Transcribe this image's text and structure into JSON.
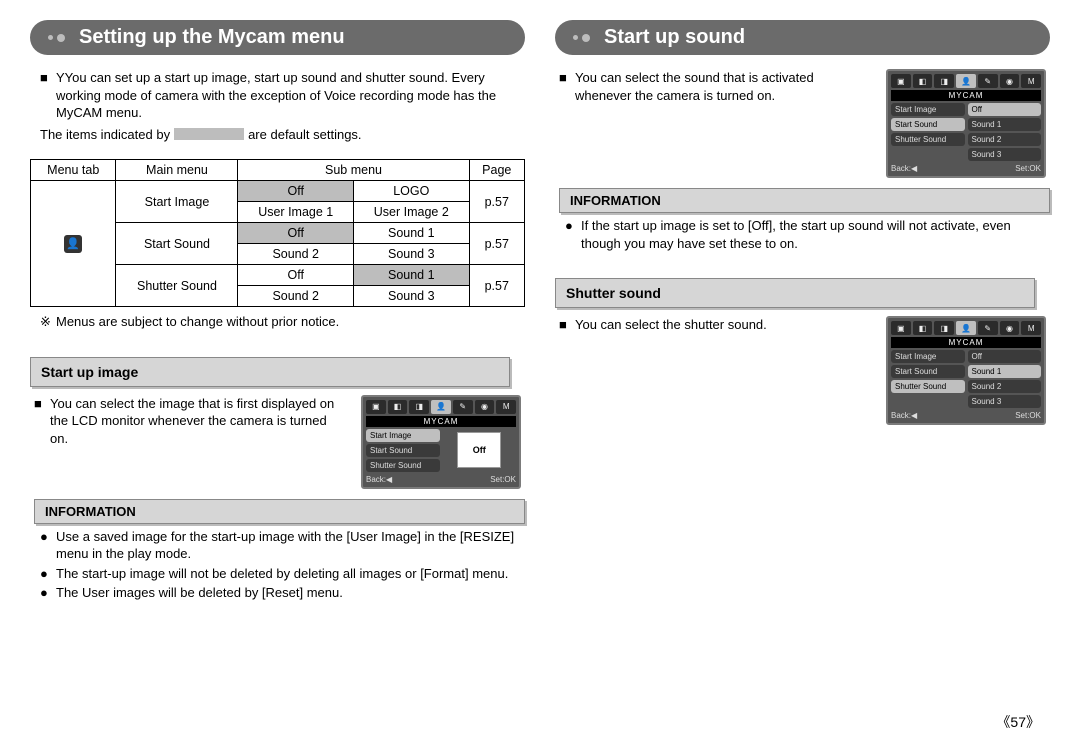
{
  "left": {
    "head": "Setting up the Mycam menu",
    "intro": "YYou can set up a start up image, start up sound and shutter sound. Every working mode of camera with the exception of Voice recording mode has the MyCAM menu.",
    "defaults_prefix": "The items indicated by",
    "defaults_suffix": "are default settings.",
    "table": {
      "head": [
        "Menu tab",
        "Main menu",
        "Sub menu",
        "Page"
      ],
      "row1_main": "Start Image",
      "row1_a": "Off",
      "row1_b": "LOGO",
      "row1_c": "User Image 1",
      "row1_d": "User Image 2",
      "row1_page": "p.57",
      "row2_main": "Start Sound",
      "row2_a": "Off",
      "row2_b": "Sound 1",
      "row2_c": "Sound 2",
      "row2_d": "Sound 3",
      "row2_page": "p.57",
      "row3_main": "Shutter Sound",
      "row3_a": "Off",
      "row3_b": "Sound 1",
      "row3_c": "Sound 2",
      "row3_d": "Sound 3",
      "row3_page": "p.57"
    },
    "note": "Menus are subject to change without prior notice.",
    "section1_title": "Start up image",
    "section1_text": "You can select the image that is first displayed on the LCD monitor whenever the camera is turned on.",
    "info_title": "INFORMATION",
    "info_items": [
      "Use a saved image for the start-up image with the [User Image] in the [RESIZE] menu in the play mode.",
      "The start-up image will not be deleted by deleting all images or [Format] menu.",
      "The User images will be deleted by [Reset] menu."
    ],
    "lcd1": {
      "title": "MYCAM",
      "left": [
        "Start Image",
        "Start Sound",
        "Shutter Sound"
      ],
      "thumb": "Off",
      "back": "Back:◀",
      "set": "Set:OK"
    }
  },
  "right": {
    "head": "Start up sound",
    "intro": "You can select the sound that is activated whenever the camera is turned on.",
    "lcd1": {
      "title": "MYCAM",
      "left": [
        "Start Image",
        "Start Sound",
        "Shutter Sound"
      ],
      "right": [
        "Off",
        "Sound 1",
        "Sound 2",
        "Sound 3"
      ],
      "back": "Back:◀",
      "set": "Set:OK"
    },
    "info_title": "INFORMATION",
    "info_text": "If the start up image is set to [Off], the start up sound will not activate, even though you may have set these to on.",
    "section2_title": "Shutter sound",
    "section2_text": "You can select the shutter sound.",
    "lcd2": {
      "title": "MYCAM",
      "left": [
        "Start Image",
        "Start Sound",
        "Shutter Sound"
      ],
      "right": [
        "Off",
        "Sound 1",
        "Sound 2",
        "Sound 3"
      ],
      "back": "Back:◀",
      "set": "Set:OK"
    }
  },
  "page_number": "《57》"
}
